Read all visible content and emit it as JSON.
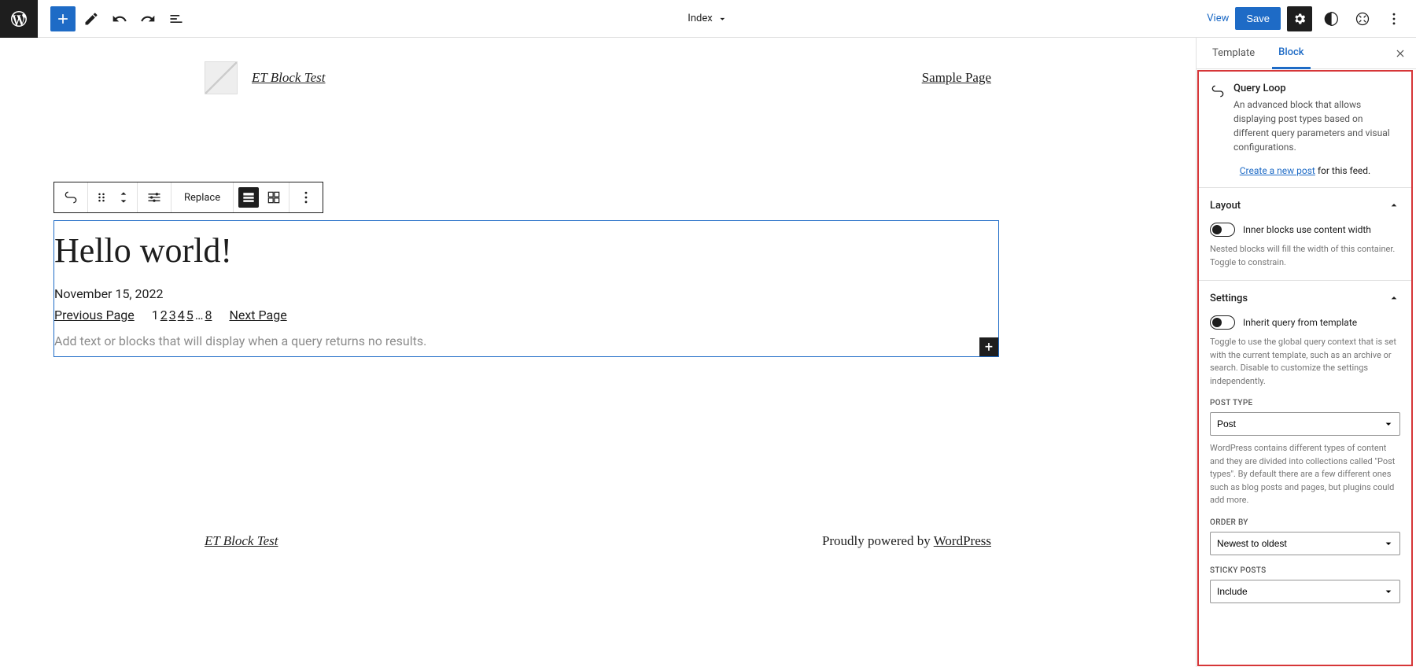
{
  "topbar": {
    "center_label": "Index",
    "view_label": "View",
    "save_label": "Save"
  },
  "site": {
    "title": "ET Block Test",
    "nav_item": "Sample Page"
  },
  "block_toolbar": {
    "replace_label": "Replace"
  },
  "post": {
    "title": "Hello world!",
    "date": "November 15, 2022"
  },
  "pagination": {
    "prev": "Previous Page",
    "next": "Next Page",
    "pages": [
      "1",
      "2",
      "3",
      "4",
      "5",
      "…",
      "8"
    ]
  },
  "no_results_placeholder": "Add text or blocks that will display when a query returns no results.",
  "footer": {
    "title": "ET Block Test",
    "credit_prefix": "Proudly powered by ",
    "credit_link": "WordPress"
  },
  "sidebar": {
    "tabs": {
      "template": "Template",
      "block": "Block"
    },
    "block_name": "Query Loop",
    "block_desc": "An advanced block that allows displaying post types based on different query parameters and visual configurations.",
    "create_link": "Create a new post",
    "create_suffix": " for this feed.",
    "panels": {
      "layout_title": "Layout",
      "layout_toggle": "Inner blocks use content width",
      "layout_help": "Nested blocks will fill the width of this container. Toggle to constrain.",
      "settings_title": "Settings",
      "settings_toggle": "Inherit query from template",
      "settings_help": "Toggle to use the global query context that is set with the current template, such as an archive or search. Disable to customize the settings independently.",
      "post_type_label": "POST TYPE",
      "post_type_value": "Post",
      "post_type_help": "WordPress contains different types of content and they are divided into collections called \"Post types\". By default there are a few different ones such as blog posts and pages, but plugins could add more.",
      "order_label": "ORDER BY",
      "order_value": "Newest to oldest",
      "sticky_label": "STICKY POSTS",
      "sticky_value": "Include"
    }
  }
}
